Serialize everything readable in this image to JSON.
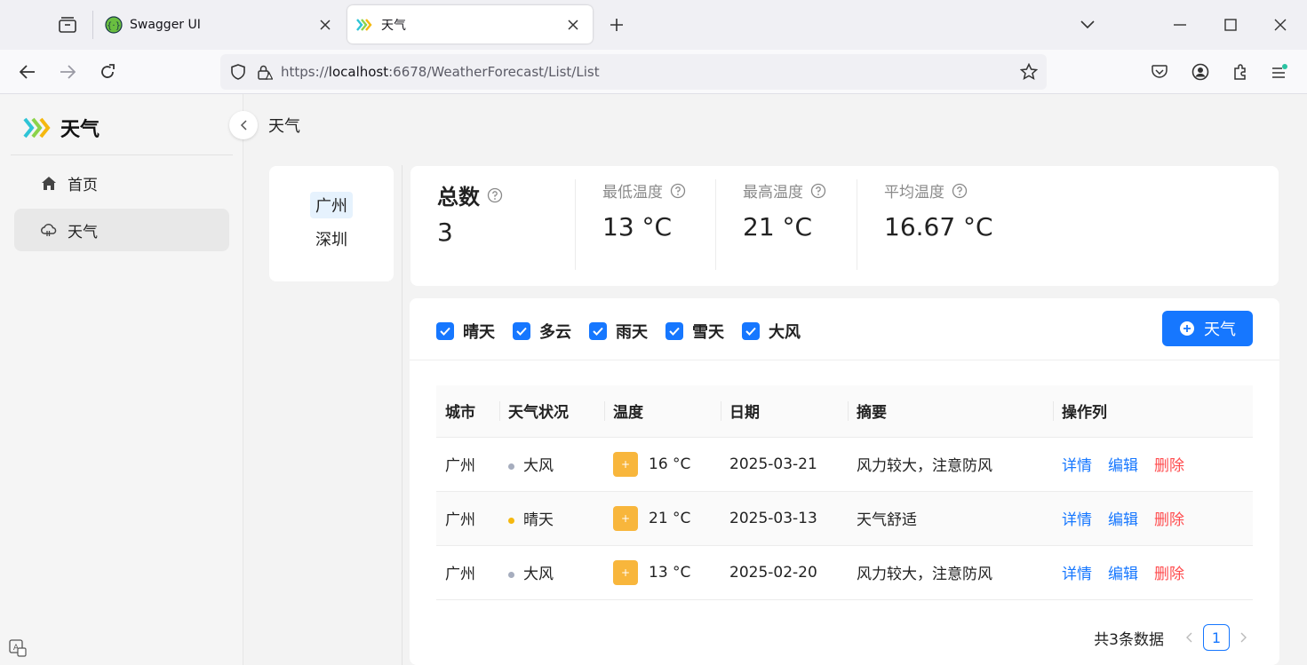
{
  "browser": {
    "tabs": [
      {
        "title": "Swagger UI",
        "active": false
      },
      {
        "title": "天气",
        "active": true
      }
    ],
    "url_prefix": "https://",
    "url_host": "localhost",
    "url_rest": ":6678/WeatherForecast/List/List"
  },
  "sidebar": {
    "logo_text": "天气",
    "items": [
      {
        "label": "首页",
        "icon": "home-icon",
        "active": false
      },
      {
        "label": "天气",
        "icon": "cloud-icon",
        "active": true
      }
    ]
  },
  "breadcrumb": "天气",
  "cities": [
    {
      "name": "广州",
      "selected": true
    },
    {
      "name": "深圳",
      "selected": false
    }
  ],
  "stats": [
    {
      "label": "总数",
      "value": "3"
    },
    {
      "label": "最低温度",
      "value": "13 °C"
    },
    {
      "label": "最高温度",
      "value": "21 °C"
    },
    {
      "label": "平均温度",
      "value": "16.67 °C"
    }
  ],
  "filters": [
    "晴天",
    "多云",
    "雨天",
    "雪天",
    "大风"
  ],
  "add_button_label": "天气",
  "table": {
    "headers": [
      "城市",
      "天气状况",
      "温度",
      "日期",
      "摘要",
      "操作列"
    ],
    "rows": [
      {
        "city": "广州",
        "weather": "大风",
        "dot_color": "#a6adbe",
        "temp": "16 °C",
        "date": "2025-03-21",
        "summary": "风力较大，注意防风"
      },
      {
        "city": "广州",
        "weather": "晴天",
        "dot_color": "#f5b80f",
        "temp": "21 °C",
        "date": "2025-03-13",
        "summary": "天气舒适"
      },
      {
        "city": "广州",
        "weather": "大风",
        "dot_color": "#a6adbe",
        "temp": "13 °C",
        "date": "2025-02-20",
        "summary": "风力较大，注意防风"
      }
    ],
    "actions": {
      "detail": "详情",
      "edit": "编辑",
      "delete": "删除"
    },
    "temp_badge_symbol": "+"
  },
  "pagination": {
    "total_text": "共3条数据",
    "current_page": "1"
  },
  "colors": {
    "primary": "#1677ff",
    "danger": "#ff4d4f",
    "temp_badge": "#f8b63c"
  }
}
